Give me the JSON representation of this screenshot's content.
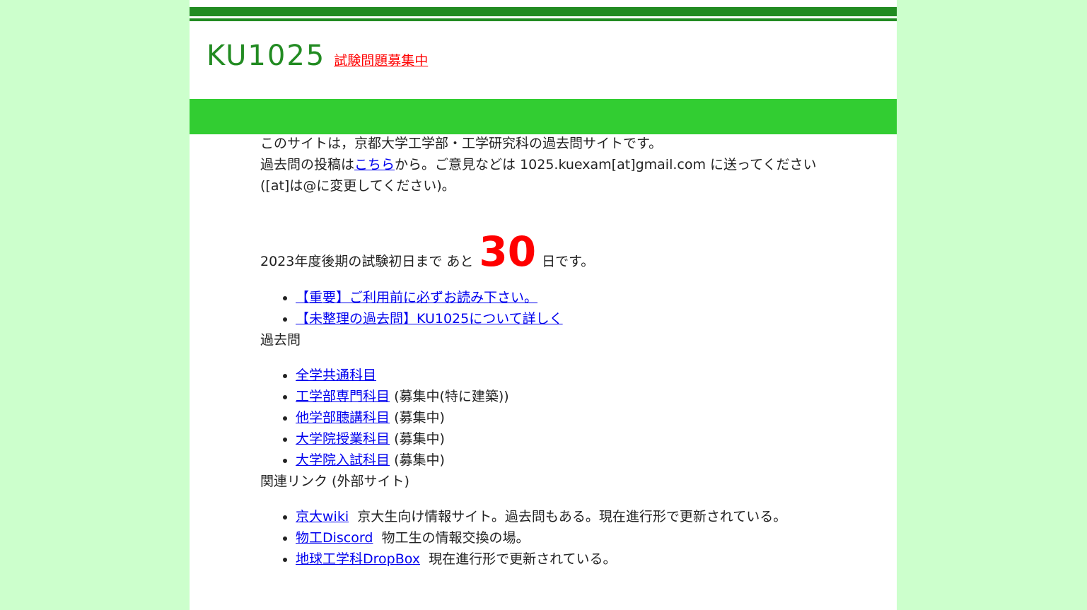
{
  "header": {
    "title": "KU1025",
    "recruit_link": "試験問題募集中"
  },
  "intro": {
    "line1": "このサイトは，京都大学工学部・工学研究科の過去問サイトです。",
    "line2_prefix": "過去問の投稿は",
    "line2_link": "こちら",
    "line2_suffix": "から。ご意見などは 1025.kuexam[at]gmail.com に送ってください([at]は@に変更してください)。"
  },
  "countdown": {
    "prefix": "2023年度後期の試験初日まで あと",
    "days": "30",
    "suffix": "日です。"
  },
  "notices": [
    "【重要】ご利用前に必ずお読み下さい。",
    "【未整理の過去問】KU1025について詳しく"
  ],
  "past_exams": {
    "heading": "過去問",
    "items": [
      {
        "link": "全学共通科目",
        "note": ""
      },
      {
        "link": "工学部専門科目",
        "note": "(募集中(特に建築))"
      },
      {
        "link": "他学部聴講科目",
        "note": "(募集中)"
      },
      {
        "link": "大学院授業科目",
        "note": "(募集中)"
      },
      {
        "link": "大学院入試科目",
        "note": "(募集中)"
      }
    ]
  },
  "related": {
    "heading": "関連リンク (外部サイト)",
    "items": [
      {
        "link": "京大wiki",
        "desc": "京大生向け情報サイト。過去問もある。現在進行形で更新されている。"
      },
      {
        "link": "物工Discord",
        "desc": "物工生の情報交換の場。"
      },
      {
        "link": "地球工学科DropBox",
        "desc": "現在進行形で更新されている。"
      }
    ]
  },
  "colors": {
    "background": "#ccffcc",
    "title_green": "#228b22",
    "bar_green": "#32cd32",
    "countdown_red": "#ff0000",
    "link_blue": "#0000ee"
  }
}
